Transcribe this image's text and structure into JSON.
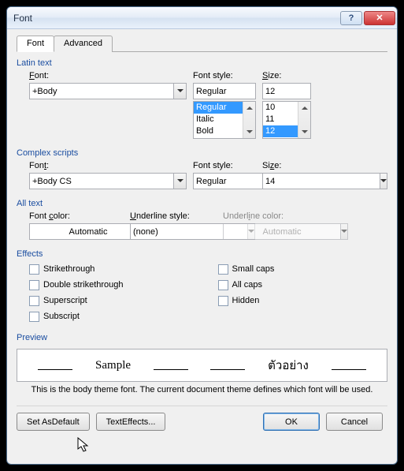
{
  "title": "Font",
  "tabs": {
    "font": "Font",
    "advanced": "Advanced"
  },
  "latin": {
    "group": "Latin text",
    "font_label": "Font:",
    "font_value": "+Body",
    "style_label": "Font style:",
    "style_value": "Regular",
    "style_options": [
      "Regular",
      "Italic",
      "Bold"
    ],
    "size_label": "Size:",
    "size_value": "12",
    "size_options": [
      "10",
      "11",
      "12"
    ]
  },
  "complex": {
    "group": "Complex scripts",
    "font_label": "Font:",
    "font_value": "+Body CS",
    "style_label": "Font style:",
    "style_value": "Regular",
    "size_label": "Size:",
    "size_value": "14"
  },
  "alltext": {
    "group": "All text",
    "color_label": "Font color:",
    "color_value": "Automatic",
    "ustyle_label": "Underline style:",
    "ustyle_value": "(none)",
    "ucolor_label": "Underline color:",
    "ucolor_value": "Automatic"
  },
  "effects": {
    "group": "Effects",
    "strike": "Strikethrough",
    "dstrike": "Double strikethrough",
    "super": "Superscript",
    "sub": "Subscript",
    "smallcaps": "Small caps",
    "allcaps": "All caps",
    "hidden": "Hidden"
  },
  "preview": {
    "group": "Preview",
    "sample1": "Sample",
    "sample2": "ตัวอย่าง",
    "desc": "This is the body theme font. The current document theme defines which font will be used."
  },
  "buttons": {
    "setdefault": "Set As Default",
    "texteffects": "Text Effects...",
    "ok": "OK",
    "cancel": "Cancel"
  }
}
